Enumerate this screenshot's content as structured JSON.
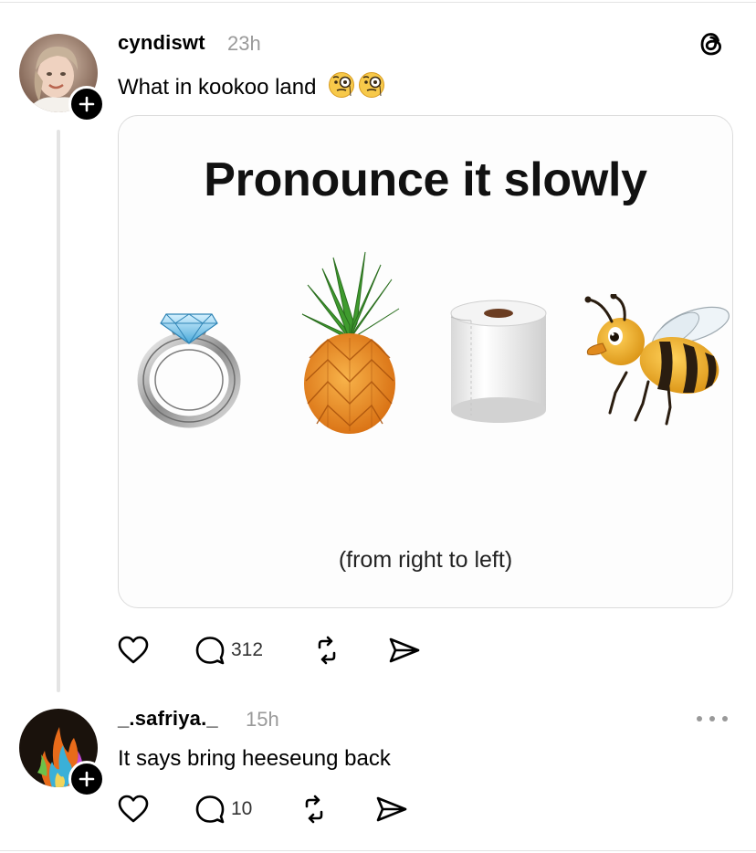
{
  "posts": [
    {
      "username": "cyndiswt",
      "time": "23h",
      "text": "What in kookoo land",
      "text_emojis": "🧐🧐",
      "media": {
        "title": "Pronounce it slowly",
        "caption": "(from right to left)",
        "emoji_items": [
          "ring-emoji",
          "pineapple-emoji",
          "toilet-paper-emoji",
          "bee-emoji"
        ]
      },
      "actions": {
        "like_count": "",
        "reply_count": "312",
        "repost_count": "",
        "share_count": ""
      }
    },
    {
      "username": "_.safriya._",
      "time": "15h",
      "text": "It says bring heeseung back",
      "actions": {
        "like_count": "",
        "reply_count": "10",
        "repost_count": "",
        "share_count": ""
      }
    }
  ],
  "icons": {
    "logo": "threads-logo-icon",
    "follow": "plus-icon",
    "like": "heart-icon",
    "reply": "comment-bubble-icon",
    "repost": "repost-icon",
    "share": "send-icon",
    "more": "more-dots-icon"
  },
  "colors": {
    "text": "#000000",
    "muted": "#9a9a9a",
    "divider": "#e3e3e3"
  }
}
